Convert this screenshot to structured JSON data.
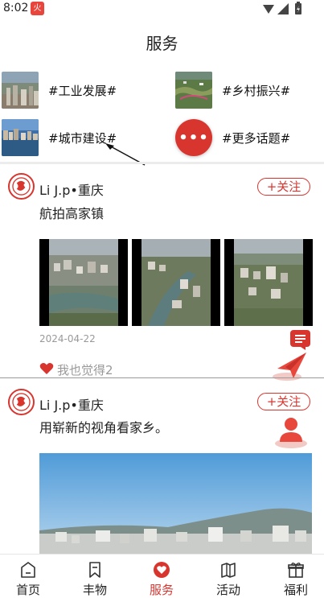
{
  "status": {
    "time": "8:02",
    "app_badge": "火"
  },
  "page": {
    "title": "服务"
  },
  "topics": [
    {
      "label": "#工业发展#"
    },
    {
      "label": "#乡村振兴#"
    },
    {
      "label": "#城市建设#"
    },
    {
      "label": "#更多话题#"
    }
  ],
  "posts": [
    {
      "author": "Li J.p•重庆",
      "follow": "+关注",
      "text": "航拍高家镇",
      "date": "2024-04-22",
      "likes": "我也觉得2"
    },
    {
      "author": "Li J.p•重庆",
      "follow": "+关注",
      "text": "用崭新的视角看家乡。"
    }
  ],
  "nav": [
    {
      "label": "首页",
      "icon": "home-icon",
      "active": false
    },
    {
      "label": "丰物",
      "icon": "bookmark-icon",
      "active": false
    },
    {
      "label": "服务",
      "icon": "heart-icon",
      "active": true
    },
    {
      "label": "活动",
      "icon": "map-icon",
      "active": false
    },
    {
      "label": "福利",
      "icon": "gift-icon",
      "active": false
    }
  ],
  "colors": {
    "accent": "#d8352f",
    "muted": "#999999"
  }
}
